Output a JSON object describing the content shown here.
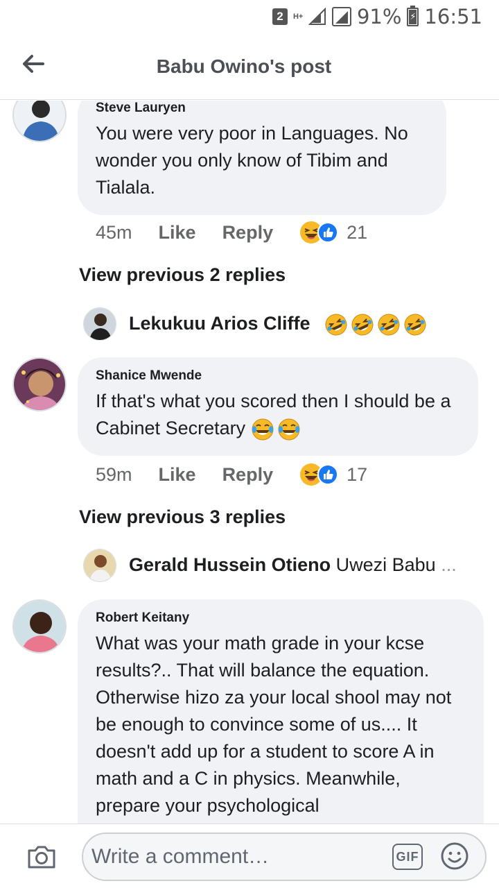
{
  "status_bar": {
    "sim_badge": "2",
    "network": "H+",
    "battery_percent": "91%",
    "time": "16:51"
  },
  "header": {
    "title": "Babu Owino's post",
    "back_icon": "arrow-left-icon"
  },
  "comments": [
    {
      "author": "Steve Lauryen",
      "text": "You were very poor in Languages. No wonder you only know of Tibim and Tialala.",
      "time": "45m",
      "like_label": "Like",
      "reply_label": "Reply",
      "reactions": [
        "haha",
        "like"
      ],
      "reaction_count": "21",
      "view_previous": "View previous 2 replies",
      "latest_reply": {
        "author": "Lekukuu Arios Cliffe",
        "snippet": "",
        "emoji": [
          "rolling-on-floor-laughing",
          "rolling-on-floor-laughing",
          "rolling-on-floor-laughing",
          "rolling-on-floor-laughing"
        ]
      }
    },
    {
      "author": "Shanice Mwende",
      "text": "If that's what you scored then I should be a Cabinet Secretary",
      "text_emoji": [
        "tears-of-joy",
        "tears-of-joy"
      ],
      "time": "59m",
      "like_label": "Like",
      "reply_label": "Reply",
      "reactions": [
        "haha",
        "like"
      ],
      "reaction_count": "17",
      "view_previous": "View previous 3 replies",
      "latest_reply": {
        "author": "Gerald Hussein Otieno",
        "snippet": "Uwezi Babu",
        "more": "..."
      }
    },
    {
      "author": "Robert Keitany",
      "text": "What was your math grade in your kcse results?.. That will balance the equation. Otherwise hizo za your local shool may not be enough to convince some of us.... It doesn't add up for a student to score A in math and a C in physics. Meanwhile, prepare your psychological"
    }
  ],
  "composer": {
    "placeholder": "Write a comment…",
    "gif_label": "GIF",
    "camera_icon": "camera-icon",
    "sticker_icon": "smiley-icon"
  },
  "colors": {
    "bubble": "#f0f2f5",
    "like_blue": "#1877f2",
    "haha_yellow": "#f7b928",
    "text": "#1c1e21",
    "muted": "#65676b"
  }
}
